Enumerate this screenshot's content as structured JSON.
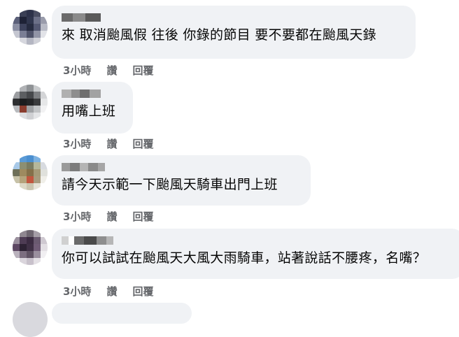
{
  "comments": [
    {
      "text": "來 取消颱風假 往後 你錄的節目 要不要都在颱風天錄",
      "time": "3小時",
      "like": "讚",
      "reply": "回覆"
    },
    {
      "text": "用嘴上班",
      "time": "3小時",
      "like": "讚",
      "reply": "回覆"
    },
    {
      "text": "請今天示範一下颱風天騎車出門上班",
      "time": "3小時",
      "like": "讚",
      "reply": "回覆"
    },
    {
      "text": "你可以試試在颱風天大風大雨騎車，站著說話不腰疼，名嘴？",
      "time": "3小時",
      "like": "讚",
      "reply": "回覆"
    }
  ],
  "colors": {
    "bubble": "#f0f2f5",
    "meta": "#65676b",
    "text": "#050505"
  }
}
